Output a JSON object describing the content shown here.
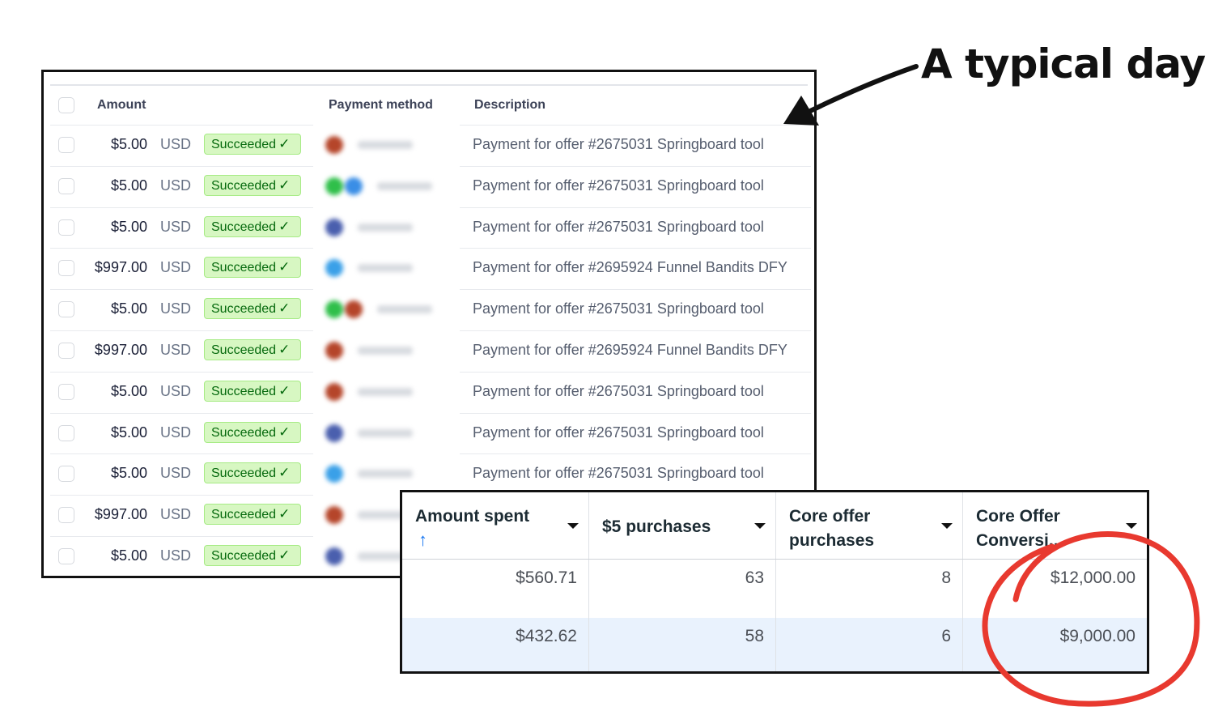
{
  "annotation": {
    "text": "A typical day"
  },
  "payments": {
    "headers": {
      "amount": "Amount",
      "payment_method": "Payment method",
      "description": "Description"
    },
    "rows": [
      {
        "amount": "$5.00",
        "currency": "USD",
        "status": "Succeeded",
        "description": "Payment for offer #2675031 Springboard tool",
        "dots": [
          "#b5452a"
        ]
      },
      {
        "amount": "$5.00",
        "currency": "USD",
        "status": "Succeeded",
        "description": "Payment for offer #2675031 Springboard tool",
        "dots": [
          "#2fbf4a",
          "#3a8ee6"
        ]
      },
      {
        "amount": "$5.00",
        "currency": "USD",
        "status": "Succeeded",
        "description": "Payment for offer #2675031 Springboard tool",
        "dots": [
          "#4a5fae"
        ]
      },
      {
        "amount": "$997.00",
        "currency": "USD",
        "status": "Succeeded",
        "description": "Payment for offer #2695924 Funnel Bandits DFY",
        "dots": [
          "#3aa0e8"
        ]
      },
      {
        "amount": "$5.00",
        "currency": "USD",
        "status": "Succeeded",
        "description": "Payment for offer #2675031 Springboard tool",
        "dots": [
          "#2fbf4a",
          "#b5452a"
        ]
      },
      {
        "amount": "$997.00",
        "currency": "USD",
        "status": "Succeeded",
        "description": "Payment for offer #2695924 Funnel Bandits DFY",
        "dots": [
          "#b5452a"
        ]
      },
      {
        "amount": "$5.00",
        "currency": "USD",
        "status": "Succeeded",
        "description": "Payment for offer #2675031 Springboard tool",
        "dots": [
          "#b5452a"
        ]
      },
      {
        "amount": "$5.00",
        "currency": "USD",
        "status": "Succeeded",
        "description": "Payment for offer #2675031 Springboard tool",
        "dots": [
          "#4a5fae"
        ]
      },
      {
        "amount": "$5.00",
        "currency": "USD",
        "status": "Succeeded",
        "description": "Payment for offer #2675031 Springboard tool",
        "dots": [
          "#3aa0e8"
        ]
      },
      {
        "amount": "$997.00",
        "currency": "USD",
        "status": "Succeeded",
        "description": "",
        "dots": [
          "#b5452a"
        ]
      },
      {
        "amount": "$5.00",
        "currency": "USD",
        "status": "Succeeded",
        "description": "",
        "dots": [
          "#4a5fae"
        ]
      }
    ]
  },
  "ads_table": {
    "headers": {
      "amount_spent": "Amount spent",
      "five_purchases": "$5 purchases",
      "core_offer_purchases_1": "Core offer",
      "core_offer_purchases_2": "purchases",
      "core_offer_conv_1": "Core Offer",
      "core_offer_conv_2": "Conversi..."
    },
    "rows": [
      {
        "amount_spent": "$560.71",
        "five_purchases": "63",
        "core_offer_purchases": "8",
        "core_offer_conv": "$12,000.00"
      },
      {
        "amount_spent": "$432.62",
        "five_purchases": "58",
        "core_offer_purchases": "6",
        "core_offer_conv": "$9,000.00"
      }
    ]
  },
  "colors": {
    "badge_bg": "#d7f7c2",
    "badge_text": "#05690d",
    "circle": "#e8392f",
    "sort_arrow": "#1877f2"
  }
}
